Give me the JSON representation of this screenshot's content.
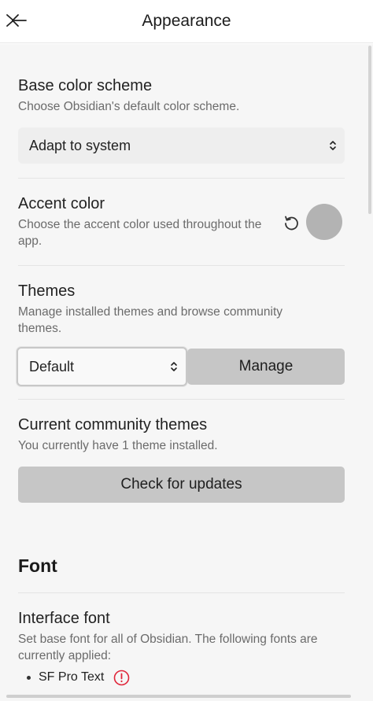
{
  "header": {
    "title": "Appearance",
    "back_icon": "collapse-back-icon"
  },
  "base_color_scheme": {
    "title": "Base color scheme",
    "description": "Choose Obsidian's default color scheme.",
    "selected": "Adapt to system"
  },
  "accent_color": {
    "title": "Accent color",
    "description": "Choose the accent color used throughout the app.",
    "swatch_color": "#b3b3b3",
    "reset_icon": "reset-icon"
  },
  "themes": {
    "title": "Themes",
    "description": "Manage installed themes and browse community themes.",
    "selected": "Default",
    "manage_label": "Manage"
  },
  "community_themes": {
    "title": "Current community themes",
    "description": "You currently have 1 theme installed.",
    "check_label": "Check for updates"
  },
  "font_section": {
    "heading": "Font"
  },
  "interface_font": {
    "title": "Interface font",
    "description": "Set base font for all of Obsidian. The following fonts are currently applied:",
    "fonts": [
      "SF Pro Text"
    ],
    "warning_color": "#e0263a"
  }
}
